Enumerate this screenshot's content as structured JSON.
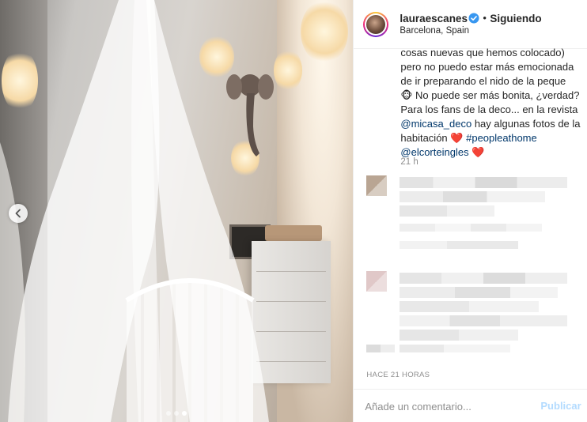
{
  "post": {
    "user": {
      "username": "lauraescanes",
      "verified": true,
      "follow_separator": "•",
      "follow_label": "Siguiendo",
      "location": "Barcelona, Spain"
    },
    "caption_lines": [
      "cosas nuevas que hemos colocado)",
      "pero no puedo estar más emocionada",
      "de ir preparando el nido de la peque",
      "No puede ser más bonita, ¿verdad?",
      "Para los fans de la deco... en la revista",
      "hay algunas fotos de la",
      "habitación",
      ""
    ],
    "caption_emoji": "🐵",
    "caption_mention_micasa": "@micasa_deco",
    "caption_hashtag": "#peopleathome",
    "caption_mention_corte": "@elcorteingles",
    "heart": "❤️",
    "caption_time": "21 h",
    "timestamp": "HACE 21 HORAS",
    "comment_placeholder": "Añade un comentario...",
    "publish_label": "Publicar",
    "carousel": {
      "total": 3,
      "active": 3
    }
  },
  "colors": {
    "link": "#00376b",
    "publish_disabled": "#b3dbff",
    "verified_blue": "#3897f0",
    "heart_red": "#ed4956",
    "secondary_text": "#8e8e8e"
  },
  "icons": {
    "carousel_prev": "chevron-left-icon",
    "verified": "verified-badge-icon",
    "more": "more-options-icon"
  }
}
